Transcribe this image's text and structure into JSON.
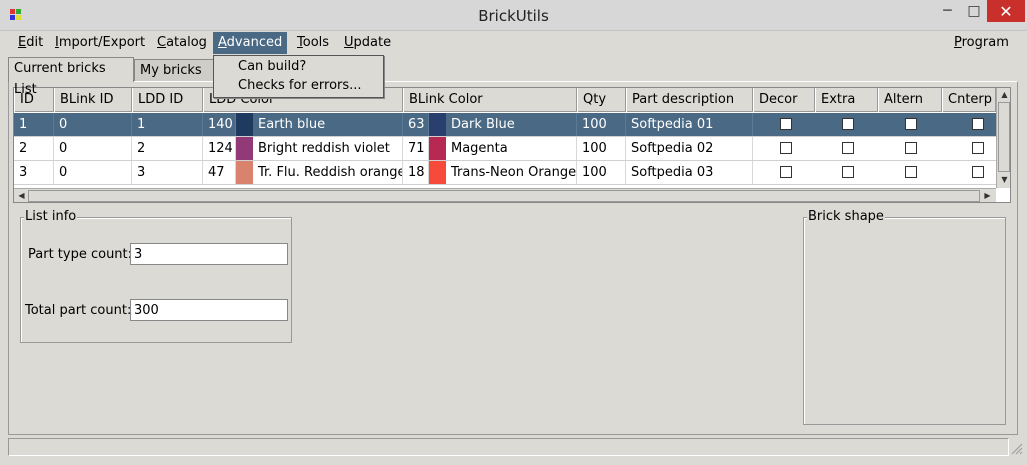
{
  "window": {
    "title": "BrickUtils",
    "minimize": "─",
    "maximize": "□",
    "close": "✕"
  },
  "menubar": {
    "items": [
      {
        "key": "E",
        "rest": "dit"
      },
      {
        "key": "I",
        "rest": "mport/Export"
      },
      {
        "key": "C",
        "rest": "atalog"
      },
      {
        "key": "A",
        "rest": "dvanced"
      },
      {
        "key": "T",
        "rest": "ools"
      },
      {
        "key": "U",
        "rest": "pdate"
      },
      {
        "key": "P",
        "rest": "rogram"
      }
    ]
  },
  "advanced_menu": {
    "items": [
      "Can build?",
      "Checks for errors..."
    ]
  },
  "tabs": [
    "Current bricks List",
    "My bricks ca"
  ],
  "table": {
    "columns": [
      "ID",
      "BLink ID",
      "LDD ID",
      "LDD Color",
      "BLink Color",
      "Qty",
      "Part description",
      "Decor",
      "Extra",
      "Altern",
      "Cnterp"
    ],
    "rows": [
      {
        "id": "1",
        "blink_id": "0",
        "ldd_id": "1",
        "ldd_color_code": "140",
        "ldd_color_hex": "#1f3a5f",
        "ldd_color_name": "Earth blue",
        "blink_color_code": "63",
        "blink_color_hex": "#2a3f6e",
        "blink_color_name": "Dark Blue",
        "qty": "100",
        "description": "Softpedia 01",
        "selected": true
      },
      {
        "id": "2",
        "blink_id": "0",
        "ldd_id": "2",
        "ldd_color_code": "124",
        "ldd_color_hex": "#923978",
        "ldd_color_name": "Bright reddish violet",
        "blink_color_code": "71",
        "blink_color_hex": "#b52952",
        "blink_color_name": "Magenta",
        "qty": "100",
        "description": "Softpedia 02",
        "selected": false
      },
      {
        "id": "3",
        "blink_id": "0",
        "ldd_id": "3",
        "ldd_color_code": "47",
        "ldd_color_hex": "#d9826e",
        "ldd_color_name": "Tr. Flu. Reddish orange",
        "blink_color_code": "18",
        "blink_color_hex": "#f74a3a",
        "blink_color_name": "Trans-Neon Orange",
        "qty": "100",
        "description": "Softpedia 03",
        "selected": false
      }
    ]
  },
  "list_info": {
    "legend": "List info",
    "part_type_label": "Part type count:",
    "part_type_value": "3",
    "total_part_label": "Total part count:",
    "total_part_value": "300"
  },
  "brick_shape": {
    "legend": "Brick shape"
  },
  "colors": {
    "selection": "#4a6984",
    "window_bg": "#dcdad5",
    "close": "#c9302c"
  }
}
